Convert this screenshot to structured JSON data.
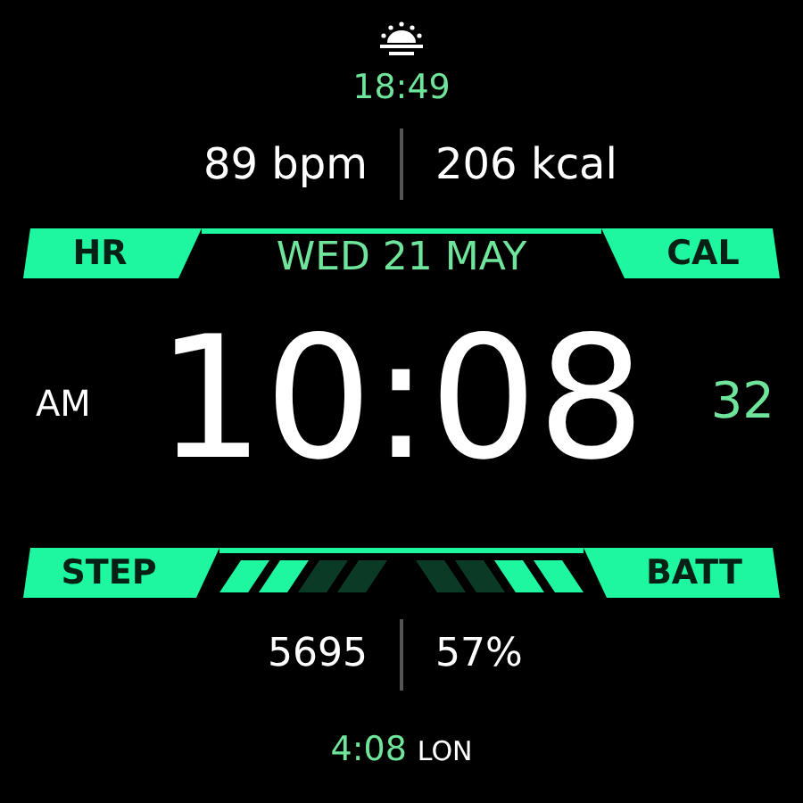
{
  "sun_event": {
    "time": "18:49"
  },
  "top_stats": [
    "89 bpm",
    "206 kcal"
  ],
  "top_band": {
    "left_label": "HR",
    "center": "WED 21 MAY",
    "right_label": "CAL"
  },
  "time": {
    "period": "AM",
    "main": "10:08",
    "seconds": "32"
  },
  "bottom_band": {
    "left_label": "STEP",
    "right_label": "BATT",
    "step_gauge": {
      "level": 0.5
    },
    "battery_gauge": {
      "level": 0.5
    }
  },
  "bottom_stats": [
    "5695",
    "57%"
  ],
  "world_clock": {
    "time": "4:08",
    "city": "LON"
  }
}
